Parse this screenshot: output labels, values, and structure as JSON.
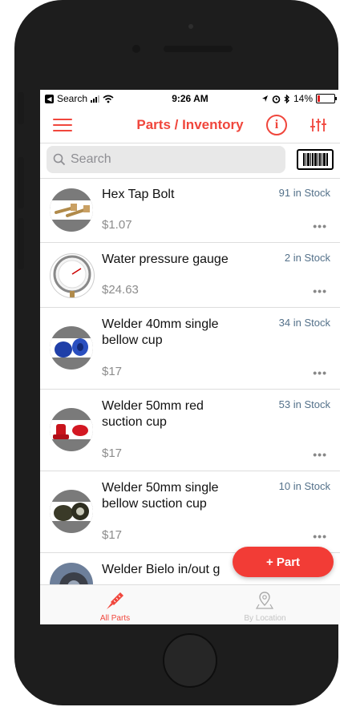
{
  "status_bar": {
    "back_app": "Search",
    "time": "9:26 AM",
    "battery": "14%"
  },
  "nav": {
    "title": "Parts / Inventory",
    "info_glyph": "i"
  },
  "search": {
    "placeholder": "Search"
  },
  "parts": [
    {
      "name": "Hex Tap Bolt",
      "stock": "91 in Stock",
      "price": "$1.07",
      "more": "•••",
      "thumb_icon": "bolt-icon"
    },
    {
      "name": "Water pressure gauge",
      "stock": "2 in Stock",
      "price": "$24.63",
      "more": "•••",
      "thumb_icon": "gauge-icon"
    },
    {
      "name": "Welder 40mm single bellow cup",
      "stock": "34 in Stock",
      "price": "$17",
      "more": "•••",
      "thumb_icon": "blue-cup-icon"
    },
    {
      "name": "Welder 50mm red suction cup",
      "stock": "53 in Stock",
      "price": "$17",
      "more": "•••",
      "thumb_icon": "red-cup-icon"
    },
    {
      "name": "Welder 50mm single bellow suction cup",
      "stock": "10 in Stock",
      "price": "$17",
      "more": "•••",
      "thumb_icon": "black-cup-icon"
    },
    {
      "name": "Welder Bielo in/out g",
      "thumb_icon": "bearing-icon"
    }
  ],
  "fab": {
    "label": "+ Part"
  },
  "tabs": [
    {
      "label": "All Parts",
      "icon": "screw-icon",
      "active": true
    },
    {
      "label": "By Location",
      "icon": "map-pin-icon",
      "active": false
    }
  ],
  "colors": {
    "accent": "#f0463c",
    "stock_text": "#54718a",
    "price_text": "#8c8c8c"
  }
}
